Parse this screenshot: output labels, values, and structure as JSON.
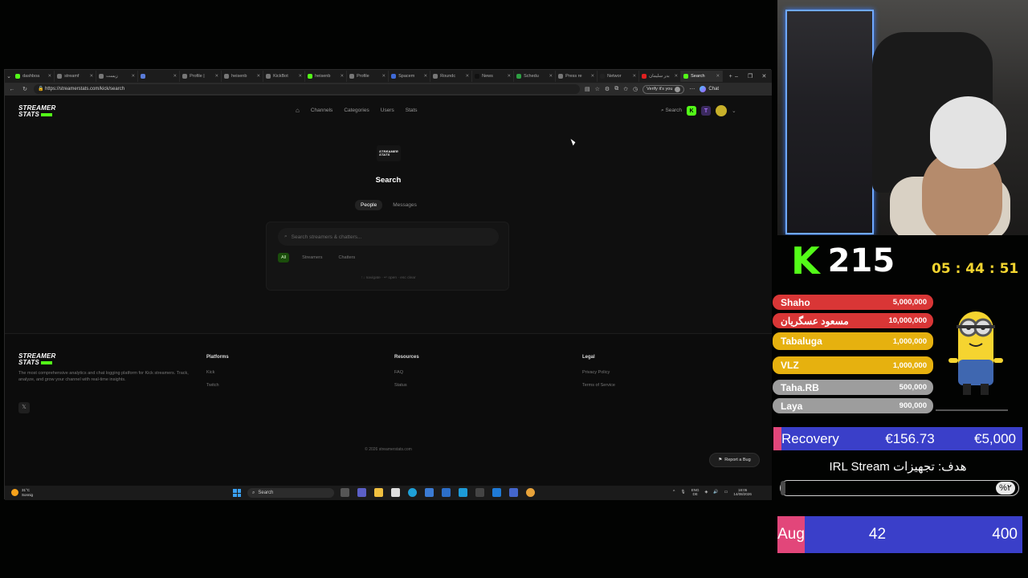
{
  "browser": {
    "tabs": [
      {
        "label": "dashboa",
        "color": "#53fc18"
      },
      {
        "label": "streamf",
        "color": "#777"
      },
      {
        "label": "زیست",
        "color": "#777"
      },
      {
        "label": "",
        "color": "#5a7bd8"
      },
      {
        "label": "Profile |",
        "color": "#777"
      },
      {
        "label": "heisenb",
        "color": "#777"
      },
      {
        "label": "KickBot",
        "color": "#777"
      },
      {
        "label": "heisenb",
        "color": "#53fc18"
      },
      {
        "label": "Profile",
        "color": "#777"
      },
      {
        "label": "Spacem",
        "color": "#3f6ad8"
      },
      {
        "label": "Roundc",
        "color": "#777"
      },
      {
        "label": "News",
        "color": "#111"
      },
      {
        "label": "Schedu",
        "color": "#2ea043"
      },
      {
        "label": "Press re",
        "color": "#777"
      },
      {
        "label": "Networ",
        "color": "#222"
      },
      {
        "label": "بدر سلیمان",
        "color": "#e02020"
      },
      {
        "label": "Search",
        "color": "#53fc18",
        "active": true
      }
    ],
    "url": "https://streamerstats.com/kick/search",
    "verify_label": "Verify it's you",
    "chat_label": "Chat"
  },
  "site": {
    "logo_line1": "STREAMER",
    "logo_line2": "STATS",
    "nav": [
      "Channels",
      "Categories",
      "Users",
      "Stats"
    ],
    "search_label": "Search",
    "page_title": "Search",
    "tabs": [
      "People",
      "Messages"
    ],
    "search_placeholder": "Search streamers & chatters...",
    "filters": [
      "All",
      "Streamers",
      "Chatters"
    ],
    "hints": "↑↓ navigate · ↵ open · esc clear"
  },
  "footer": {
    "description": "The most comprehensive analytics and chat logging platform for Kick streamers. Track, analyze, and grow your channel with real-time insights.",
    "x_icon_label": "𝕏",
    "platforms_heading": "Platforms",
    "platforms": [
      "Kick",
      "Twitch"
    ],
    "resources_heading": "Resources",
    "resources": [
      "FAQ",
      "Status"
    ],
    "legal_heading": "Legal",
    "legal": [
      "Privacy Policy",
      "Terms of Service"
    ],
    "copyright": "© 2026 streamerstats.com",
    "report_bug": "Report a Bug"
  },
  "taskbar": {
    "temp": "31°C",
    "weather": "Sonnig",
    "search": "Search",
    "lang1": "ENG",
    "lang2": "DE",
    "time": "18:05",
    "date": "14/08/2026"
  },
  "overlay": {
    "kick_letter": "K",
    "viewers": "215",
    "timer": "05 : 44 : 51",
    "donors": [
      {
        "name": "Shaho",
        "amount": "5,000,000",
        "color": "#d93636"
      },
      {
        "name": "مسعود عسگریان",
        "amount": "10,000,000",
        "color": "#d93636"
      },
      {
        "name": "Tabaluga",
        "amount": "1,000,000",
        "color": "#e6b10f"
      },
      {
        "name": "VLZ",
        "amount": "1,000,000",
        "color": "#e6b10f"
      },
      {
        "name": "Taha.RB",
        "amount": "500,000",
        "color": "#9d9d9d"
      },
      {
        "name": "Laya",
        "amount": "900,000",
        "color": "#9d9d9d"
      }
    ],
    "recovery_label": "Recovery",
    "recovery_current": "€156.73",
    "recovery_goal": "€5,000",
    "goal_title": "هدف: تجهیزات IRL Stream",
    "goal_percent": "%۲",
    "goal_fraction": 0.02,
    "aug_label": "Aug",
    "aug_current": "42",
    "aug_goal": "400",
    "accent": "#53fc18",
    "bar_blue": "#3a3fc9",
    "bar_pink": "#e2467a"
  }
}
